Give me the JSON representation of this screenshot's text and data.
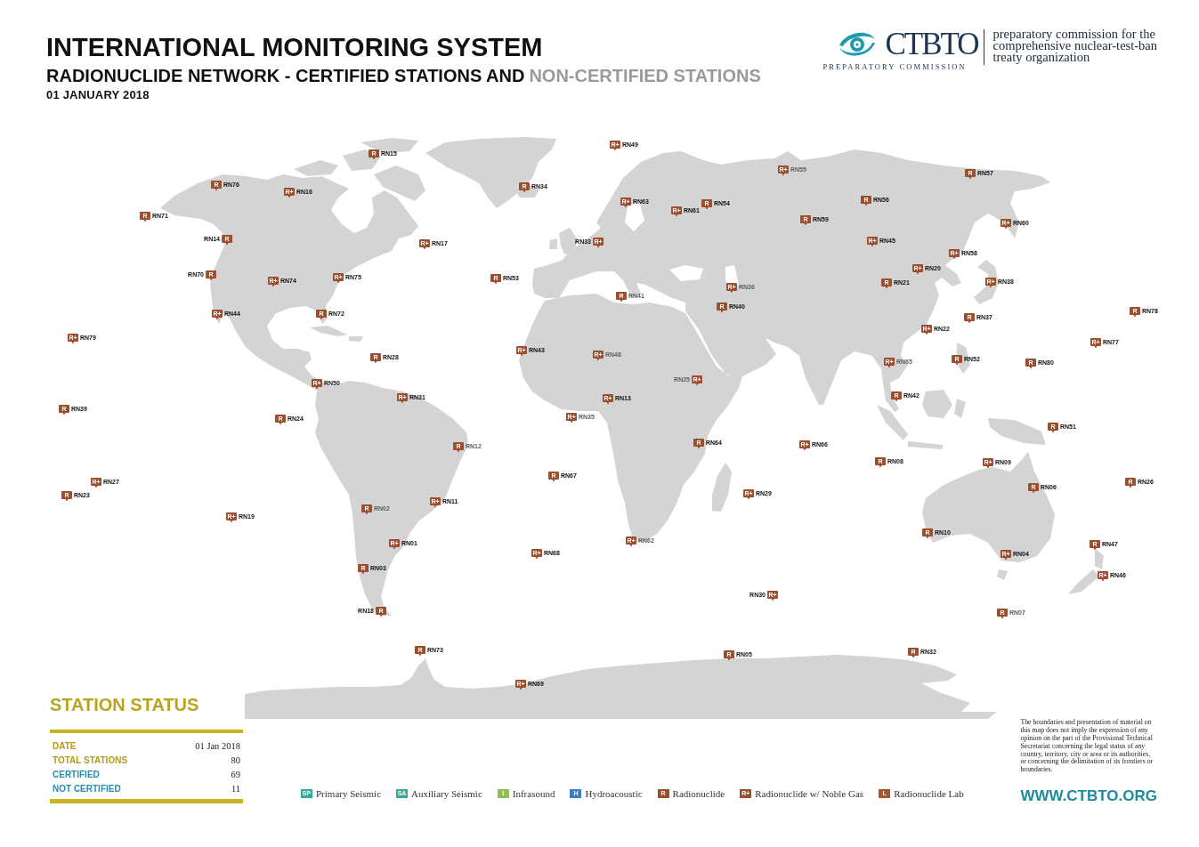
{
  "header": {
    "title": "INTERNATIONAL MONITORING SYSTEM",
    "subtitle": "RADIONUCLIDE NETWORK - CERTIFIED STATIONS AND",
    "subtitle_muted": "NON-CERTIFIED STATIONS",
    "date": "01 JANUARY 2018"
  },
  "logo": {
    "wordmark": "CTBTO",
    "tagline": "PREPARATORY COMMISSION",
    "description": "preparatory commission for the\ncomprehensive nuclear-test-ban\ntreaty organization"
  },
  "stations": [
    {
      "label": "RN15",
      "code": "R",
      "certified": true
    },
    {
      "label": "RN76",
      "code": "R",
      "certified": true
    },
    {
      "label": "RN16",
      "code": "R+",
      "certified": true
    },
    {
      "label": "RN34",
      "code": "R",
      "certified": true
    },
    {
      "label": "RN71",
      "code": "R",
      "certified": true
    },
    {
      "label": "RN14",
      "code": "R",
      "certified": true
    },
    {
      "label": "RN17",
      "code": "R+",
      "certified": true
    },
    {
      "label": "RN33",
      "code": "R+",
      "certified": true
    },
    {
      "label": "RN70",
      "code": "R",
      "certified": true
    },
    {
      "label": "RN74",
      "code": "R+",
      "certified": true
    },
    {
      "label": "RN75",
      "code": "R+",
      "certified": true
    },
    {
      "label": "RN53",
      "code": "R",
      "certified": true
    },
    {
      "label": "RN44",
      "code": "R+",
      "certified": true
    },
    {
      "label": "RN72",
      "code": "R",
      "certified": true
    },
    {
      "label": "RN79",
      "code": "R+",
      "certified": true
    },
    {
      "label": "RN28",
      "code": "R",
      "certified": true
    },
    {
      "label": "RN43",
      "code": "R+",
      "certified": true
    },
    {
      "label": "RN50",
      "code": "R+",
      "certified": true
    },
    {
      "label": "RN31",
      "code": "R+",
      "certified": true
    },
    {
      "label": "RN39",
      "code": "R",
      "certified": true
    },
    {
      "label": "RN24",
      "code": "R",
      "certified": true
    },
    {
      "label": "RN35",
      "code": "R+",
      "certified": false
    },
    {
      "label": "RN49",
      "code": "R+",
      "certified": true
    },
    {
      "label": "RN55",
      "code": "R+",
      "certified": false
    },
    {
      "label": "RN57",
      "code": "R",
      "certified": true
    },
    {
      "label": "RN63",
      "code": "R+",
      "certified": true
    },
    {
      "label": "RN61",
      "code": "R+",
      "certified": true
    },
    {
      "label": "RN54",
      "code": "R",
      "certified": true
    },
    {
      "label": "RN56",
      "code": "R",
      "certified": true
    },
    {
      "label": "RN59",
      "code": "R",
      "certified": true
    },
    {
      "label": "RN60",
      "code": "R+",
      "certified": true
    },
    {
      "label": "RN45",
      "code": "R+",
      "certified": true
    },
    {
      "label": "RN58",
      "code": "R+",
      "certified": true
    },
    {
      "label": "RN20",
      "code": "R+",
      "certified": true
    },
    {
      "label": "RN21",
      "code": "R",
      "certified": true
    },
    {
      "label": "RN36",
      "code": "R+",
      "certified": false
    },
    {
      "label": "RN38",
      "code": "R+",
      "certified": true
    },
    {
      "label": "RN41",
      "code": "R",
      "certified": false
    },
    {
      "label": "RN40",
      "code": "R",
      "certified": true
    },
    {
      "label": "RN37",
      "code": "R",
      "certified": true
    },
    {
      "label": "RN78",
      "code": "R",
      "certified": true
    },
    {
      "label": "RN22",
      "code": "R+",
      "certified": true
    },
    {
      "label": "RN77",
      "code": "R+",
      "certified": true
    },
    {
      "label": "RN48",
      "code": "R+",
      "certified": false
    },
    {
      "label": "RN52",
      "code": "R",
      "certified": true
    },
    {
      "label": "RN80",
      "code": "R",
      "certified": true
    },
    {
      "label": "RN65",
      "code": "R+",
      "certified": false
    },
    {
      "label": "RN25",
      "code": "R+",
      "certified": false
    },
    {
      "label": "RN13",
      "code": "R+",
      "certified": true
    },
    {
      "label": "RN42",
      "code": "R",
      "certified": true
    },
    {
      "label": "RN51",
      "code": "R",
      "certified": true
    },
    {
      "label": "RN12",
      "code": "R",
      "certified": false
    },
    {
      "label": "RN27",
      "code": "R+",
      "certified": true
    },
    {
      "label": "RN23",
      "code": "R",
      "certified": true
    },
    {
      "label": "RN19",
      "code": "R+",
      "certified": true
    },
    {
      "label": "RN02",
      "code": "R",
      "certified": false
    },
    {
      "label": "RN11",
      "code": "R+",
      "certified": true
    },
    {
      "label": "RN67",
      "code": "R",
      "certified": true
    },
    {
      "label": "RN01",
      "code": "R+",
      "certified": true
    },
    {
      "label": "RN68",
      "code": "R+",
      "certified": true
    },
    {
      "label": "RN03",
      "code": "R",
      "certified": true
    },
    {
      "label": "RN18",
      "code": "R",
      "certified": true
    },
    {
      "label": "RN73",
      "code": "R",
      "certified": true
    },
    {
      "label": "RN69",
      "code": "R+",
      "certified": true
    },
    {
      "label": "RN64",
      "code": "R",
      "certified": true
    },
    {
      "label": "RN66",
      "code": "R+",
      "certified": true
    },
    {
      "label": "RN08",
      "code": "R",
      "certified": true
    },
    {
      "label": "RN09",
      "code": "R+",
      "certified": true
    },
    {
      "label": "RN06",
      "code": "R",
      "certified": true
    },
    {
      "label": "RN26",
      "code": "R",
      "certified": true
    },
    {
      "label": "RN29",
      "code": "R+",
      "certified": true
    },
    {
      "label": "RN62",
      "code": "R+",
      "certified": false
    },
    {
      "label": "RN10",
      "code": "R",
      "certified": true
    },
    {
      "label": "RN47",
      "code": "R",
      "certified": true
    },
    {
      "label": "RN04",
      "code": "R+",
      "certified": true
    },
    {
      "label": "RN46",
      "code": "R+",
      "certified": true
    },
    {
      "label": "RN30",
      "code": "R+",
      "certified": true
    },
    {
      "label": "RN07",
      "code": "R",
      "certified": false
    },
    {
      "label": "RN05",
      "code": "R",
      "certified": true
    },
    {
      "label": "RN32",
      "code": "R",
      "certified": true
    }
  ],
  "station_status": {
    "title": "STATION STATUS",
    "rows": [
      {
        "label": "DATE",
        "value": "01 Jan 2018",
        "color": "#b09c1c"
      },
      {
        "label": "TOTAL STATIONS",
        "value": "80",
        "color": "#b09c1c"
      },
      {
        "label": "CERTIFIED",
        "value": "69",
        "color": "#2a8ea6"
      },
      {
        "label": "NOT CERTIFIED",
        "value": "11",
        "color": "#2a8ea6"
      }
    ]
  },
  "legend": [
    {
      "code": "SP",
      "label": "Primary Seismic",
      "color": "#36a89c"
    },
    {
      "code": "SA",
      "label": "Auxiliary Seismic",
      "color": "#36a89c"
    },
    {
      "code": "I",
      "label": "Infrasound",
      "color": "#8cc152"
    },
    {
      "code": "H",
      "label": "Hydroacoustic",
      "color": "#3d7fc1"
    },
    {
      "code": "R",
      "label": "Radionuclide",
      "color": "#9b4f2e"
    },
    {
      "code": "R+",
      "label": "Radionuclide w/ Noble Gas",
      "color": "#9b4f2e"
    },
    {
      "code": "L",
      "label": "Radionuclide Lab",
      "color": "#a4562f"
    }
  ],
  "disclaimer": "The boundaries and presentation of material on\nthis map does not imply the expression of any\nopinion on the part of the Provisional Technical\nSecretariat concerning the legal status of any\ncountry, territory, city or area or its authorities,\nor concerning the delimitation of its frontiers or\nboundaries.",
  "website": "WWW.CTBTO.ORG"
}
